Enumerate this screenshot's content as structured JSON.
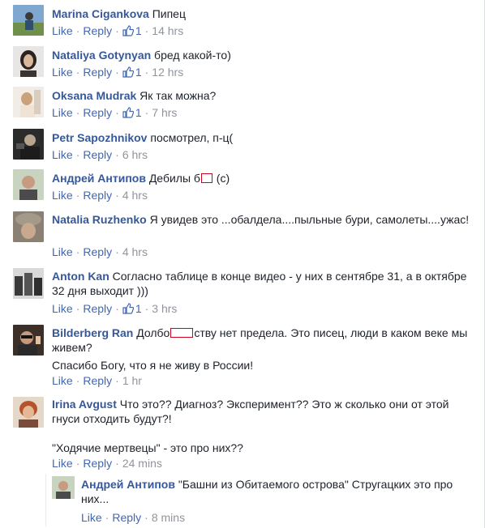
{
  "comments": [
    {
      "author": "Marina Cigankova",
      "text": "Пипец",
      "like": "Like",
      "reply": "Reply",
      "likes": "1",
      "time": "14 hrs"
    },
    {
      "author": "Nataliya Gotynyan",
      "text": "бред какой-то)",
      "like": "Like",
      "reply": "Reply",
      "likes": "1",
      "time": "12 hrs"
    },
    {
      "author": "Oksana Mudrak",
      "text": "Як так можна?",
      "like": "Like",
      "reply": "Reply",
      "likes": "1",
      "time": "7 hrs"
    },
    {
      "author": "Petr Sapozhnikov",
      "text": "посмотрел, п-ц(",
      "like": "Like",
      "reply": "Reply",
      "time": "6 hrs"
    },
    {
      "author": "Андрей Антипов",
      "text_a": "Дебилы б",
      "text_b": " (с)",
      "like": "Like",
      "reply": "Reply",
      "time": "4 hrs"
    },
    {
      "author": "Natalia Ruzhenko",
      "text": "Я увидев это ...обалдела....пыльные бури, самолеты....ужас!",
      "like": "Like",
      "reply": "Reply",
      "time": "4 hrs"
    },
    {
      "author": "Anton Kan",
      "text": "Согласно таблице в конце видео - у них в сентябре 31, а в октябре 32 дня выходит )))",
      "like": "Like",
      "reply": "Reply",
      "likes": "1",
      "time": "3 hrs"
    },
    {
      "author": "Bilderberg Ran",
      "text_a": "Долбо",
      "text_b": "ству нет предела. Это писец, люди в каком веке мы живем?",
      "text_c": "Спасибо Богу, что я не живу в России!",
      "like": "Like",
      "reply": "Reply",
      "time": "1 hr"
    },
    {
      "author": "Irina Avgust",
      "text": "Что это?? Диагноз? Эксперимент?? Это ж сколько они от этой гнуси отходить будут?!",
      "text_c": "\"Ходячие мертвецы\" - это про них??",
      "like": "Like",
      "reply": "Reply",
      "time": "24 mins"
    }
  ],
  "reply": {
    "author": "Андрей Антипов",
    "text": "\"Башни из Обитаемого острова\" Стругацких это про них...",
    "like": "Like",
    "reply": "Reply",
    "time": "8 mins"
  },
  "dot": "·",
  "colors": {
    "name": "#365899",
    "link": "#4267b2",
    "meta": "#90949c",
    "censor": "#d0021b"
  }
}
